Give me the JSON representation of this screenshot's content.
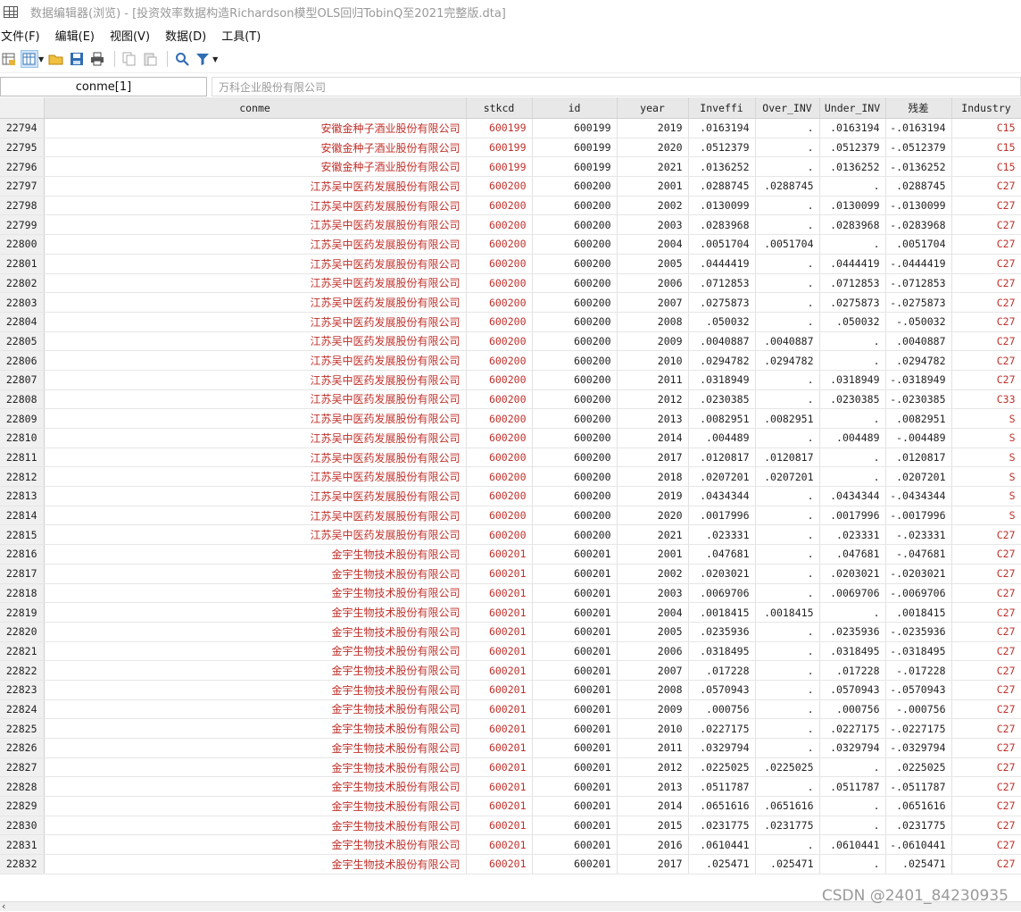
{
  "window": {
    "title": "数据编辑器(浏览) - [投资效率数据构造Richardson模型OLS回归TobinQ至2021完整版.dta]"
  },
  "menu": [
    "文件(F)",
    "编辑(E)",
    "视图(V)",
    "数据(D)",
    "工具(T)"
  ],
  "toolbar": {
    "icons": [
      "data-editor-icon",
      "view-toggle-icon",
      "open-folder-icon",
      "save-icon",
      "print-icon",
      "copy-icon",
      "paste-icon",
      "search-icon",
      "filter-icon"
    ]
  },
  "varbar": {
    "name": "conme[1]",
    "value": "万科企业股份有限公司"
  },
  "columns": [
    "conme",
    "stkcd",
    "id",
    "year",
    "Inveffi",
    "Over_INV",
    "Under_INV",
    "残差",
    "Industry"
  ],
  "rows": [
    [
      "22794",
      "安徽金种子酒业股份有限公司",
      "600199",
      "600199",
      "2019",
      ".0163194",
      ".",
      ".0163194",
      "-.0163194",
      "C15"
    ],
    [
      "22795",
      "安徽金种子酒业股份有限公司",
      "600199",
      "600199",
      "2020",
      ".0512379",
      ".",
      ".0512379",
      "-.0512379",
      "C15"
    ],
    [
      "22796",
      "安徽金种子酒业股份有限公司",
      "600199",
      "600199",
      "2021",
      ".0136252",
      ".",
      ".0136252",
      "-.0136252",
      "C15"
    ],
    [
      "22797",
      "江苏吴中医药发展股份有限公司",
      "600200",
      "600200",
      "2001",
      ".0288745",
      ".0288745",
      ".",
      ".0288745",
      "C27"
    ],
    [
      "22798",
      "江苏吴中医药发展股份有限公司",
      "600200",
      "600200",
      "2002",
      ".0130099",
      ".",
      ".0130099",
      "-.0130099",
      "C27"
    ],
    [
      "22799",
      "江苏吴中医药发展股份有限公司",
      "600200",
      "600200",
      "2003",
      ".0283968",
      ".",
      ".0283968",
      "-.0283968",
      "C27"
    ],
    [
      "22800",
      "江苏吴中医药发展股份有限公司",
      "600200",
      "600200",
      "2004",
      ".0051704",
      ".0051704",
      ".",
      ".0051704",
      "C27"
    ],
    [
      "22801",
      "江苏吴中医药发展股份有限公司",
      "600200",
      "600200",
      "2005",
      ".0444419",
      ".",
      ".0444419",
      "-.0444419",
      "C27"
    ],
    [
      "22802",
      "江苏吴中医药发展股份有限公司",
      "600200",
      "600200",
      "2006",
      ".0712853",
      ".",
      ".0712853",
      "-.0712853",
      "C27"
    ],
    [
      "22803",
      "江苏吴中医药发展股份有限公司",
      "600200",
      "600200",
      "2007",
      ".0275873",
      ".",
      ".0275873",
      "-.0275873",
      "C27"
    ],
    [
      "22804",
      "江苏吴中医药发展股份有限公司",
      "600200",
      "600200",
      "2008",
      ".050032",
      ".",
      ".050032",
      "-.050032",
      "C27"
    ],
    [
      "22805",
      "江苏吴中医药发展股份有限公司",
      "600200",
      "600200",
      "2009",
      ".0040887",
      ".0040887",
      ".",
      ".0040887",
      "C27"
    ],
    [
      "22806",
      "江苏吴中医药发展股份有限公司",
      "600200",
      "600200",
      "2010",
      ".0294782",
      ".0294782",
      ".",
      ".0294782",
      "C27"
    ],
    [
      "22807",
      "江苏吴中医药发展股份有限公司",
      "600200",
      "600200",
      "2011",
      ".0318949",
      ".",
      ".0318949",
      "-.0318949",
      "C27"
    ],
    [
      "22808",
      "江苏吴中医药发展股份有限公司",
      "600200",
      "600200",
      "2012",
      ".0230385",
      ".",
      ".0230385",
      "-.0230385",
      "C33"
    ],
    [
      "22809",
      "江苏吴中医药发展股份有限公司",
      "600200",
      "600200",
      "2013",
      ".0082951",
      ".0082951",
      ".",
      ".0082951",
      "S"
    ],
    [
      "22810",
      "江苏吴中医药发展股份有限公司",
      "600200",
      "600200",
      "2014",
      ".004489",
      ".",
      ".004489",
      "-.004489",
      "S"
    ],
    [
      "22811",
      "江苏吴中医药发展股份有限公司",
      "600200",
      "600200",
      "2017",
      ".0120817",
      ".0120817",
      ".",
      ".0120817",
      "S"
    ],
    [
      "22812",
      "江苏吴中医药发展股份有限公司",
      "600200",
      "600200",
      "2018",
      ".0207201",
      ".0207201",
      ".",
      ".0207201",
      "S"
    ],
    [
      "22813",
      "江苏吴中医药发展股份有限公司",
      "600200",
      "600200",
      "2019",
      ".0434344",
      ".",
      ".0434344",
      "-.0434344",
      "S"
    ],
    [
      "22814",
      "江苏吴中医药发展股份有限公司",
      "600200",
      "600200",
      "2020",
      ".0017996",
      ".",
      ".0017996",
      "-.0017996",
      "S"
    ],
    [
      "22815",
      "江苏吴中医药发展股份有限公司",
      "600200",
      "600200",
      "2021",
      ".023331",
      ".",
      ".023331",
      "-.023331",
      "C27"
    ],
    [
      "22816",
      "金宇生物技术股份有限公司",
      "600201",
      "600201",
      "2001",
      ".047681",
      ".",
      ".047681",
      "-.047681",
      "C27"
    ],
    [
      "22817",
      "金宇生物技术股份有限公司",
      "600201",
      "600201",
      "2002",
      ".0203021",
      ".",
      ".0203021",
      "-.0203021",
      "C27"
    ],
    [
      "22818",
      "金宇生物技术股份有限公司",
      "600201",
      "600201",
      "2003",
      ".0069706",
      ".",
      ".0069706",
      "-.0069706",
      "C27"
    ],
    [
      "22819",
      "金宇生物技术股份有限公司",
      "600201",
      "600201",
      "2004",
      ".0018415",
      ".0018415",
      ".",
      ".0018415",
      "C27"
    ],
    [
      "22820",
      "金宇生物技术股份有限公司",
      "600201",
      "600201",
      "2005",
      ".0235936",
      ".",
      ".0235936",
      "-.0235936",
      "C27"
    ],
    [
      "22821",
      "金宇生物技术股份有限公司",
      "600201",
      "600201",
      "2006",
      ".0318495",
      ".",
      ".0318495",
      "-.0318495",
      "C27"
    ],
    [
      "22822",
      "金宇生物技术股份有限公司",
      "600201",
      "600201",
      "2007",
      ".017228",
      ".",
      ".017228",
      "-.017228",
      "C27"
    ],
    [
      "22823",
      "金宇生物技术股份有限公司",
      "600201",
      "600201",
      "2008",
      ".0570943",
      ".",
      ".0570943",
      "-.0570943",
      "C27"
    ],
    [
      "22824",
      "金宇生物技术股份有限公司",
      "600201",
      "600201",
      "2009",
      ".000756",
      ".",
      ".000756",
      "-.000756",
      "C27"
    ],
    [
      "22825",
      "金宇生物技术股份有限公司",
      "600201",
      "600201",
      "2010",
      ".0227175",
      ".",
      ".0227175",
      "-.0227175",
      "C27"
    ],
    [
      "22826",
      "金宇生物技术股份有限公司",
      "600201",
      "600201",
      "2011",
      ".0329794",
      ".",
      ".0329794",
      "-.0329794",
      "C27"
    ],
    [
      "22827",
      "金宇生物技术股份有限公司",
      "600201",
      "600201",
      "2012",
      ".0225025",
      ".0225025",
      ".",
      ".0225025",
      "C27"
    ],
    [
      "22828",
      "金宇生物技术股份有限公司",
      "600201",
      "600201",
      "2013",
      ".0511787",
      ".",
      ".0511787",
      "-.0511787",
      "C27"
    ],
    [
      "22829",
      "金宇生物技术股份有限公司",
      "600201",
      "600201",
      "2014",
      ".0651616",
      ".0651616",
      ".",
      ".0651616",
      "C27"
    ],
    [
      "22830",
      "金宇生物技术股份有限公司",
      "600201",
      "600201",
      "2015",
      ".0231775",
      ".0231775",
      ".",
      ".0231775",
      "C27"
    ],
    [
      "22831",
      "金宇生物技术股份有限公司",
      "600201",
      "600201",
      "2016",
      ".0610441",
      ".",
      ".0610441",
      "-.0610441",
      "C27"
    ],
    [
      "22832",
      "金宇生物技术股份有限公司",
      "600201",
      "600201",
      "2017",
      ".025471",
      ".025471",
      ".",
      ".025471",
      "C27"
    ]
  ],
  "colors": {
    "string_red": "#c0302a",
    "header_bg": "#e8e8e8",
    "rownum_bg": "#f0f0f0"
  },
  "watermark": "CSDN @2401_84230935"
}
